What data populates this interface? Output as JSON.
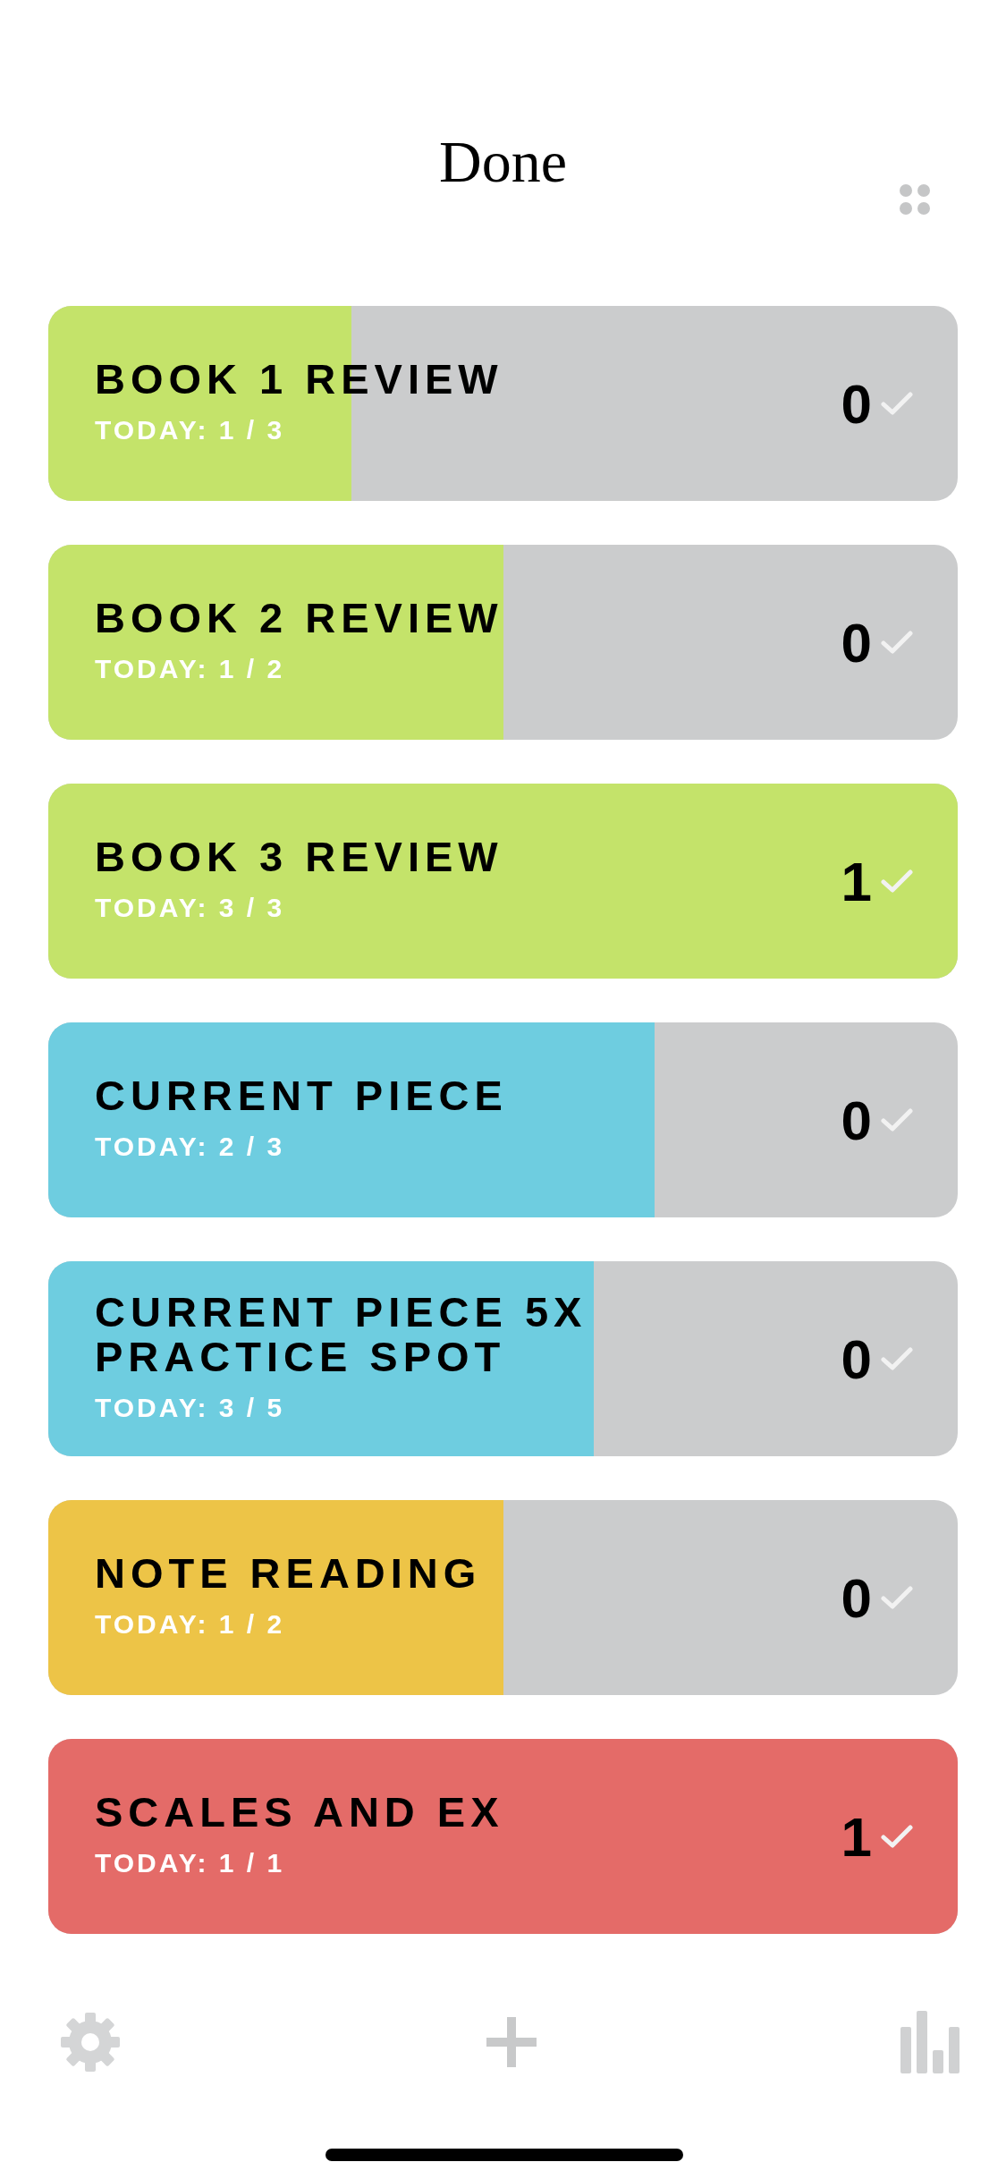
{
  "header": {
    "title": "Done"
  },
  "habits": [
    {
      "title": "BOOK 1 REVIEW",
      "today": "TODAY: 1 / 3",
      "count": "0",
      "level": 0.333,
      "color": "#c4e36a"
    },
    {
      "title": "BOOK 2 REVIEW",
      "today": "TODAY: 1 / 2",
      "count": "0",
      "level": 0.5,
      "color": "#c4e36a"
    },
    {
      "title": "BOOK 3 REVIEW",
      "today": "TODAY: 3 / 3",
      "count": "1",
      "level": 1,
      "color": "#c4e36a"
    },
    {
      "title": "CURRENT PIECE",
      "today": "TODAY: 2 / 3",
      "count": "0",
      "level": 0.667,
      "color": "#6ecde0"
    },
    {
      "title": "CURRENT PIECE 5X PRACTICE SPOT",
      "today": "TODAY: 3 / 5",
      "count": "0",
      "level": 0.6,
      "color": "#6ecde0"
    },
    {
      "title": "NOTE READING",
      "today": "TODAY: 1 / 2",
      "count": "0",
      "level": 0.5,
      "color": "#edc447"
    },
    {
      "title": "SCALES AND EX",
      "today": "TODAY: 1 / 1",
      "count": "1",
      "level": 1,
      "color": "#e46b68"
    }
  ]
}
